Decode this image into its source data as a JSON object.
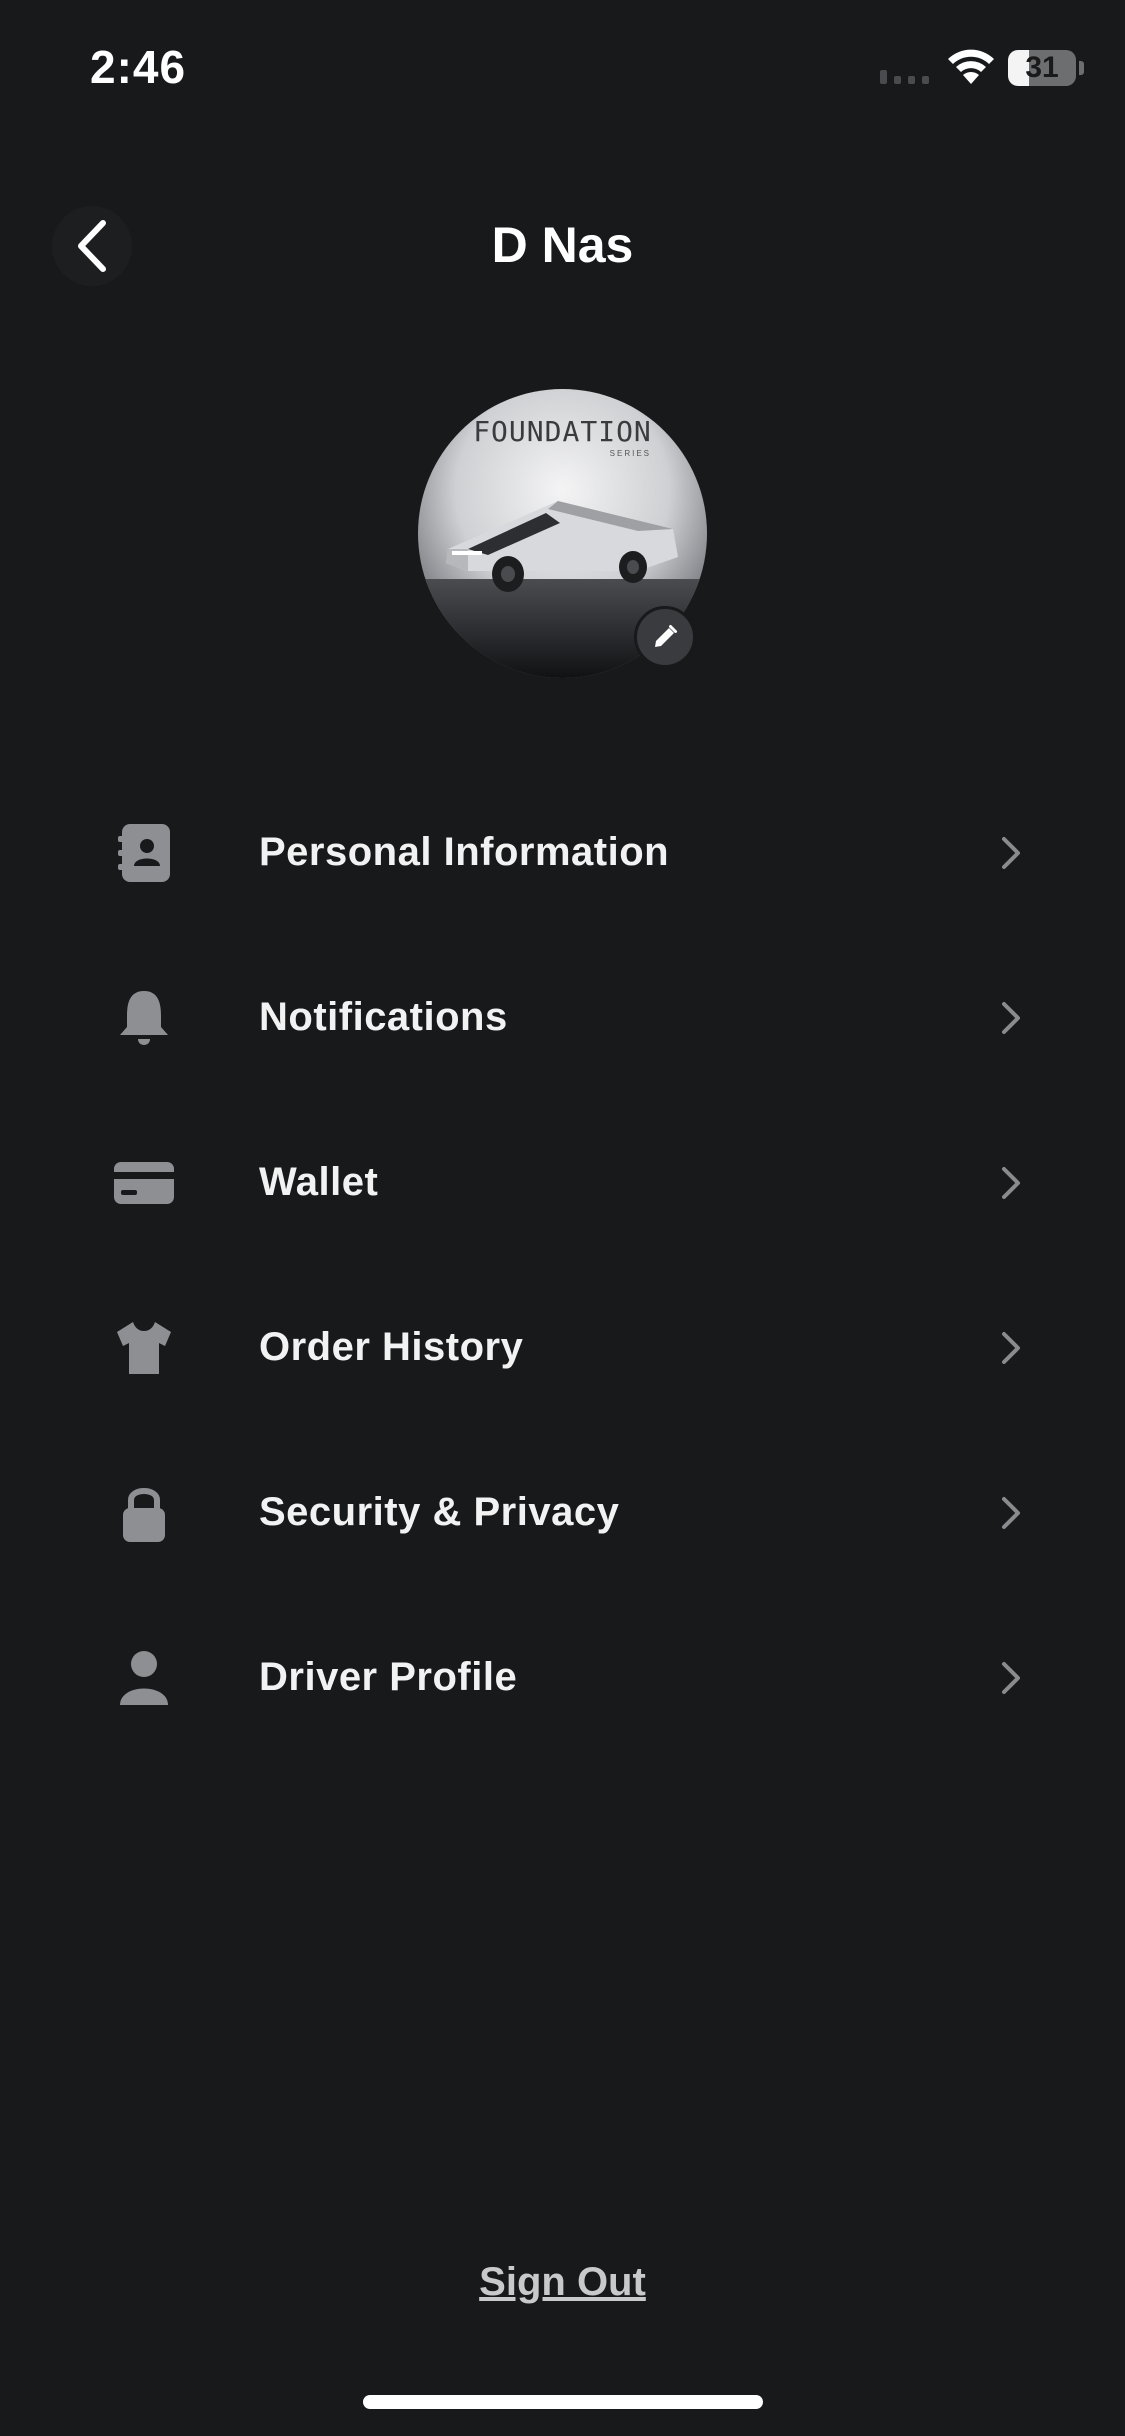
{
  "status_bar": {
    "time": "2:46",
    "battery": "31",
    "battery_level": 0.31
  },
  "header": {
    "back_icon": "chevron-left-icon",
    "title": "D Nas"
  },
  "avatar": {
    "brand_text": "FOUNDATION",
    "sub_text": "SERIES",
    "edit_icon": "pencil-icon"
  },
  "menu": {
    "items": [
      {
        "label": "Personal Information",
        "icon": "contact-card-icon"
      },
      {
        "label": "Notifications",
        "icon": "bell-icon"
      },
      {
        "label": "Wallet",
        "icon": "credit-card-icon"
      },
      {
        "label": "Order History",
        "icon": "tshirt-icon"
      },
      {
        "label": "Security & Privacy",
        "icon": "lock-icon"
      },
      {
        "label": "Driver Profile",
        "icon": "person-icon"
      }
    ]
  },
  "footer": {
    "sign_out_label": "Sign Out"
  },
  "colors": {
    "background": "#18191b",
    "text": "#f2f2f2",
    "icon": "#8e8f93",
    "chevron": "#8a8b8f"
  }
}
